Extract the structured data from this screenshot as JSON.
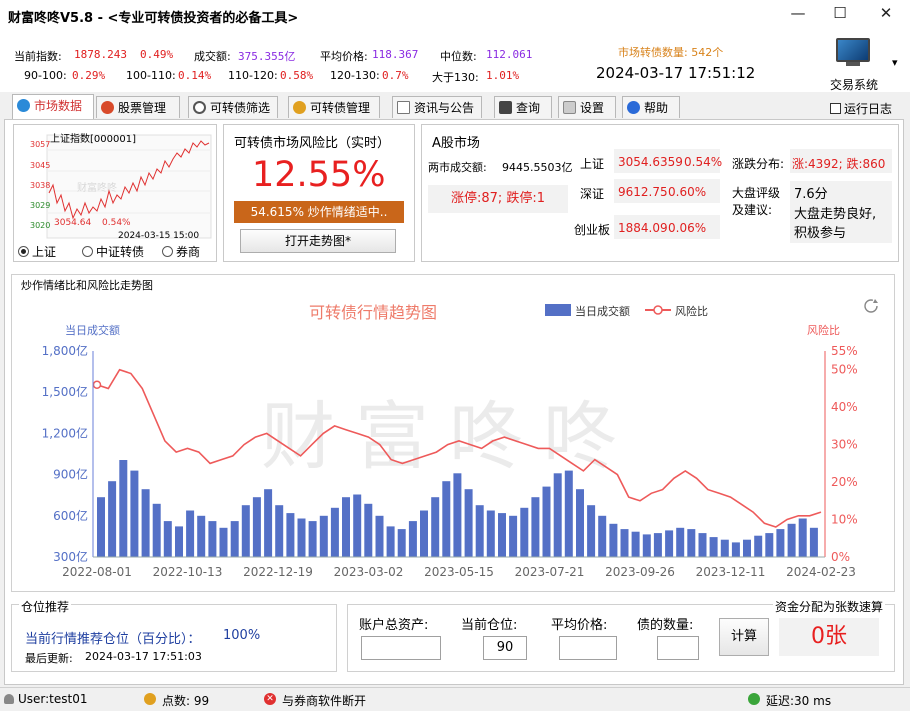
{
  "app": {
    "title": "财富咚咚V5.8 - <专业可转债投资者的必备工具>"
  },
  "window_controls": {
    "minimize": "—",
    "maximize": "☐",
    "close": "✕"
  },
  "stats": {
    "current_index_label": "当前指数:",
    "current_index_value": "1878.243",
    "current_index_pct": "0.49%",
    "volume_label": "成交额:",
    "volume_value": "375.355亿",
    "avg_price_label": "平均价格:",
    "avg_price_value": "118.367",
    "median_label": "中位数:",
    "median_value": "112.061",
    "ranges": [
      {
        "label": "90-100:",
        "value": "0.29%"
      },
      {
        "label": "100-110:",
        "value": "0.14%"
      },
      {
        "label": "110-120:",
        "value": "0.58%"
      },
      {
        "label": "120-130:",
        "value": "0.7%"
      },
      {
        "label": "大于130:",
        "value": "1.01%"
      }
    ],
    "market_count": "市场转债数量: 542个",
    "datetime": "2024-03-17 17:51:12"
  },
  "trade_system": {
    "label": "交易系统",
    "arrow": "▾",
    "run_log": "运行日志"
  },
  "tabs": [
    {
      "label": "市场数据",
      "active": true,
      "icon": "globe-icon",
      "color": "#2a8ad8"
    },
    {
      "label": "股票管理",
      "active": false,
      "icon": "stock-icon",
      "color": "#d84a2a"
    },
    {
      "label": "可转债筛选",
      "active": false,
      "icon": "filter-icon",
      "color": "#555555"
    },
    {
      "label": "可转债管理",
      "active": false,
      "icon": "coins-icon",
      "color": "#e0a020"
    },
    {
      "label": "资讯与公告",
      "active": false,
      "icon": "news-icon",
      "color": "#777777"
    },
    {
      "label": "查询",
      "active": false,
      "icon": "query-icon",
      "color": "#444444"
    },
    {
      "label": "设置",
      "active": false,
      "icon": "settings-icon",
      "color": "#999999"
    },
    {
      "label": "帮助",
      "active": false,
      "icon": "help-icon",
      "color": "#2a6ad8"
    }
  ],
  "mini_chart": {
    "title": "上证指数[000001]",
    "yticks": [
      "3057",
      "3045",
      "3038",
      "3029",
      "3020"
    ],
    "last_label": "3054.64",
    "last_pct": "0.54%",
    "time_label": "2024-03-15  15:00",
    "watermark": "财富咚咚",
    "radios": [
      {
        "label": "上证",
        "checked": true
      },
      {
        "label": "中证转债",
        "checked": false
      },
      {
        "label": "券商",
        "checked": false
      }
    ]
  },
  "risk": {
    "title": "可转债市场风险比（实时）",
    "value": "12.55%",
    "sentiment": "54.615% 炒作情绪适中..",
    "open_trend_button": "打开走势图*"
  },
  "a_share": {
    "title": "A股市场",
    "turnover_label": "两市成交额:",
    "turnover_value": "9445.5503亿",
    "limit_text": "涨停:87;  跌停:1",
    "indices": [
      {
        "name": "上证",
        "value": "3054.6359",
        "pct": "0.54%"
      },
      {
        "name": "深证",
        "value": "9612.75",
        "pct": "0.60%"
      },
      {
        "name": "创业板",
        "value": "1884.09",
        "pct": "0.06%"
      }
    ],
    "distribution_label": "涨跌分布:",
    "distribution_value": "涨:4392;  跌:860",
    "rating_label": "大盘评级\n及建议:",
    "rating_score": "7.6分",
    "rating_advice": "大盘走势良好,\n积极参与"
  },
  "trend": {
    "section_label": "炒作情绪比和风险比走势图",
    "watermark": "财富咚咚",
    "refresh_icon": "refresh-icon"
  },
  "chart_data": {
    "type": "bar",
    "title": "可转债行情趋势图",
    "legend": [
      {
        "name": "当日成交额",
        "color": "#5470c6"
      },
      {
        "name": "风险比",
        "color": "#ee5a5a"
      }
    ],
    "legend_position": "top-right",
    "y_left": {
      "label": "当日成交额",
      "ticks": [
        "1,800亿",
        "1,500亿",
        "1,200亿",
        "900亿",
        "600亿",
        "300亿"
      ],
      "range": [
        250,
        1800
      ]
    },
    "y_right": {
      "label": "风险比",
      "ticks": [
        "55%",
        "50%",
        "40%",
        "30%",
        "20%",
        "10%",
        "0%"
      ],
      "range": [
        0,
        55
      ]
    },
    "x_labels": [
      "2022-08-01",
      "2022-10-13",
      "2022-12-19",
      "2023-03-02",
      "2023-05-15",
      "2023-07-21",
      "2023-09-26",
      "2023-12-11",
      "2024-02-23"
    ],
    "grid": false,
    "series": [
      {
        "name": "当日成交额",
        "type": "bar",
        "sampled_values": [
          700,
          820,
          980,
          900,
          760,
          650,
          520,
          480,
          600,
          560,
          520,
          470,
          520,
          640,
          700,
          760,
          640,
          580,
          540,
          520,
          560,
          620,
          700,
          720,
          650,
          560,
          480,
          460,
          520,
          600,
          700,
          820,
          880,
          760,
          640,
          600,
          580,
          560,
          620,
          700,
          780,
          880,
          900,
          760,
          640,
          560,
          500,
          460,
          440,
          420,
          430,
          450,
          470,
          460,
          430,
          400,
          380,
          360,
          380,
          410,
          430,
          460,
          500,
          540,
          470
        ]
      },
      {
        "name": "风险比",
        "type": "line",
        "sampled_values": [
          46,
          45,
          50,
          49,
          45,
          38,
          31,
          28,
          29,
          28,
          25,
          26,
          27,
          30,
          32,
          33,
          31,
          29,
          27,
          30,
          33,
          35,
          34,
          33,
          32,
          30,
          26,
          25,
          26,
          27,
          28,
          30,
          31,
          30,
          29,
          31,
          32,
          31,
          30,
          29,
          29,
          27,
          25,
          23,
          26,
          24,
          22,
          16,
          15,
          17,
          18,
          21,
          23,
          21,
          18,
          17,
          16,
          14,
          12,
          9,
          8,
          10,
          11,
          11,
          12
        ]
      }
    ]
  },
  "position": {
    "section_label": "仓位推荐",
    "recommend_label": "当前行情推荐仓位（百分比）：",
    "recommend_value": "100%",
    "last_update_label": "最后更新:",
    "last_update_value": "2024-03-17  17:51:03"
  },
  "allocation": {
    "total_assets_label": "账户总资产:",
    "current_position_label": "当前仓位:",
    "current_position_value": "90",
    "avg_price_label": "平均价格:",
    "bond_qty_label": "债的数量:",
    "calc_button": "计算",
    "result_section_label": "资金分配为张数速算",
    "result_value": "0张"
  },
  "statusbar": {
    "user": "User:test01",
    "points": "点数: 99",
    "broker": "与券商软件断开",
    "latency": "延迟:30 ms"
  }
}
